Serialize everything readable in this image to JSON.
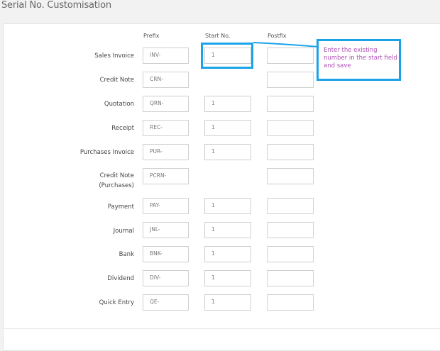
{
  "page": {
    "title": "Serial No. Customisation"
  },
  "columns": {
    "prefix": "Prefix",
    "start": "Start No.",
    "postfix": "Postfix"
  },
  "rows": [
    {
      "label": "Sales Invoice",
      "prefix": "INV-",
      "start": "1",
      "postfix": ""
    },
    {
      "label": "Credit Note",
      "prefix": "CRN-",
      "start": null,
      "postfix": ""
    },
    {
      "label": "Quotation",
      "prefix": "QRN-",
      "start": "1",
      "postfix": ""
    },
    {
      "label": "Receipt",
      "prefix": "REC-",
      "start": "1",
      "postfix": ""
    },
    {
      "label": "Purchases Invoice",
      "prefix": "PUR-",
      "start": "1",
      "postfix": ""
    },
    {
      "label": "Credit Note\n(Purchases)",
      "prefix": "PCRN-",
      "start": null,
      "postfix": ""
    },
    {
      "label": "Payment",
      "prefix": "PAY-",
      "start": "1",
      "postfix": ""
    },
    {
      "label": "Journal",
      "prefix": "JNL-",
      "start": "1",
      "postfix": ""
    },
    {
      "label": "Bank",
      "prefix": "BNK-",
      "start": "1",
      "postfix": ""
    },
    {
      "label": "Dividend",
      "prefix": "DIV-",
      "start": "1",
      "postfix": ""
    },
    {
      "label": "Quick Entry",
      "prefix": "QE-",
      "start": "1",
      "postfix": ""
    }
  ],
  "annotation": {
    "text": "Enter the existing number in the start field and save",
    "highlight_color": "#1aa3e8",
    "text_color": "#b04fb6"
  }
}
